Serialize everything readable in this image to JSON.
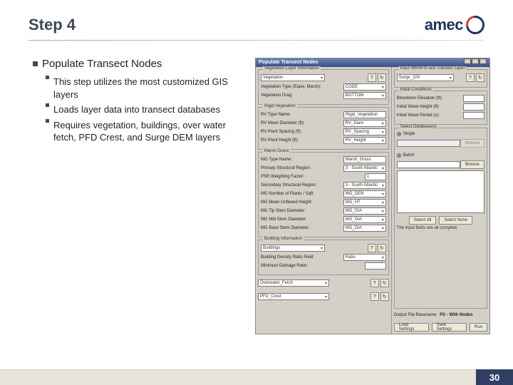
{
  "header": {
    "title": "Step 4",
    "logo_text": "amec"
  },
  "content": {
    "heading": "Populate Transect Nodes",
    "bullets": [
      "This step utilizes the most customized GIS layers",
      "Loads layer data into transect databases",
      "Requires vegetation, buildings, over water fetch, PFD Crest, and Surge DEM layers"
    ]
  },
  "dialog": {
    "title": "Populate Transect Nodes",
    "left": {
      "grp1": {
        "title": "Vegetation Layer Information",
        "layer": "Vegetation",
        "veg_type_lbl": "Vegetation Type (Equiv. Marsh):",
        "veg_type_val": "CODE",
        "veg_drag_lbl": "Vegetation Drag:",
        "veg_drag_val": "BOTTOM"
      },
      "grp2": {
        "title": "Rigid Vegetation",
        "r1_lbl": "RV Type Name:",
        "r1_val": "Rigid_Vegetation",
        "r2_lbl": "RV Mean Diameter (ft):",
        "r2_val": "RV_Diam",
        "r3_lbl": "RV Plant Spacing (ft):",
        "r3_val": "RV_Spacing",
        "r4_lbl": "RV Plant Height (ft):",
        "r4_val": "RV_Height"
      },
      "grp3": {
        "title": "Marsh Grass",
        "r1_lbl": "MG Type Name:",
        "r1_val": "Marsh_Grass",
        "r2_lbl": "Primary Structural Region:",
        "r2_val": "3 - South Atlantic",
        "r3_lbl": "PSR Weighting Factor:",
        "r3_val": "1",
        "r4_lbl": "Secondary Structural Region:",
        "r4_val": "3 - South Atlantic",
        "r5_lbl": "MG Number of Plants / Sqft:",
        "r5_val": "MG_DEN",
        "r6_lbl": "MG Mean Unflexed Height:",
        "r6_val": "MG_HT",
        "r7_lbl": "MG Tip Stem Diameter:",
        "r7_val": "MG_DIA",
        "r8_lbl": "MG Mid Stem Diameter:",
        "r8_val": "MG_DIA",
        "r9_lbl": "MG Base Stem Diameter:",
        "r9_val": "MG_DIA"
      },
      "grp4": {
        "title": "Building Information",
        "layer": "Buildings",
        "r1_lbl": "Building Density Ratio Field:",
        "r1_val": "Ratio",
        "r2_lbl": "Minimum Damage Ratio:",
        "r2_val": ""
      },
      "row_a_lbl": "Overwater_Fetch",
      "row_b_lbl": "PFD_Crest"
    },
    "right": {
      "grp1": {
        "title": "Input WHAFIS w/o Transect Layer",
        "layer": "Surge_100"
      },
      "grp2": {
        "title": "Initial Conditions",
        "r1_lbl": "Blowdown Elevation (ft):",
        "r2_lbl": "Initial Wave Height (ft):",
        "r3_lbl": "Initial Wave Period (s):"
      },
      "grp3": {
        "title": "Select Database(s)",
        "rad1": "Single",
        "rad2": "Batch",
        "browse": "Browse",
        "sel_all": "Select All",
        "sel_none": "Select None",
        "status": "The input fields are all complete"
      },
      "out_lbl": "Output File Basename:",
      "out_val": "PS - With Nodes",
      "btn1": "Load Settings",
      "btn2": "Save Settings",
      "btn3": "Run"
    }
  },
  "footer": {
    "page": "30"
  }
}
